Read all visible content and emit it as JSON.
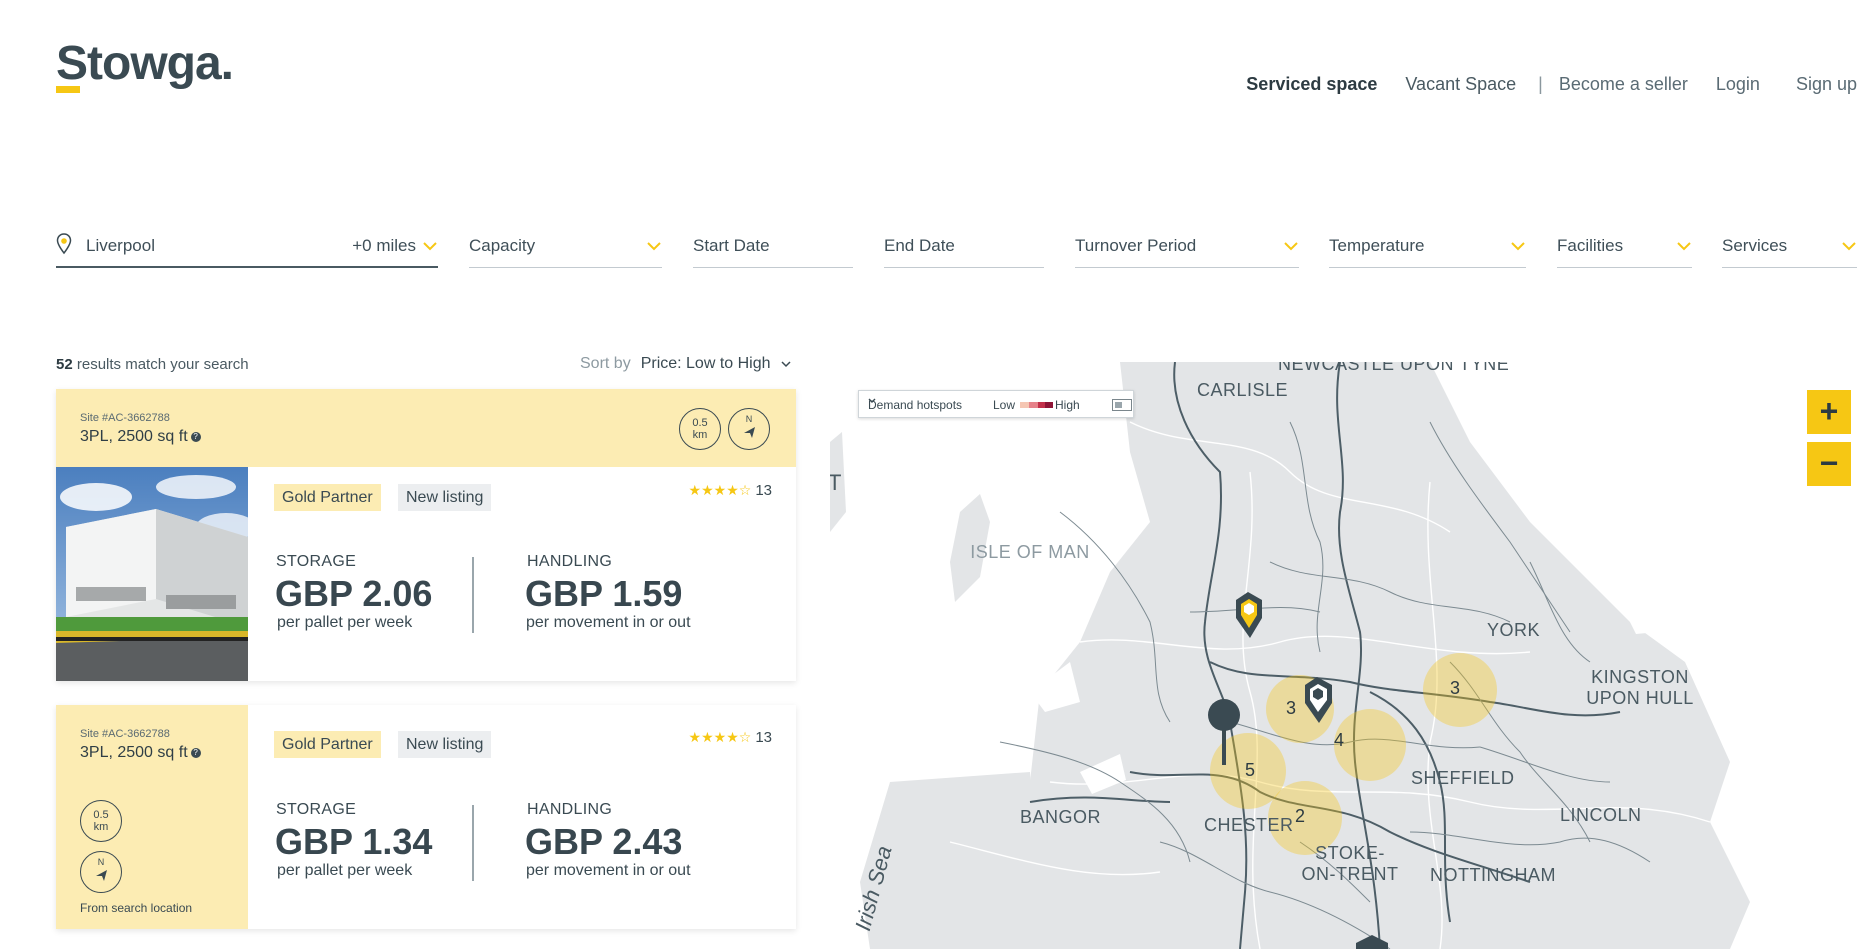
{
  "brand": {
    "name": "Stowga.",
    "accent": "#f6c714"
  },
  "nav": {
    "serviced": "Serviced space",
    "vacant": "Vacant Space",
    "separator": "|",
    "seller": "Become a seller",
    "login": "Login",
    "signup": "Sign up"
  },
  "filters": {
    "location": {
      "value": "Liverpool",
      "radius": "+0 miles"
    },
    "capacity": "Capacity",
    "start_date": "Start Date",
    "end_date": "End Date",
    "turnover": "Turnover Period",
    "temperature": "Temperature",
    "facilities": "Facilities",
    "services": "Services"
  },
  "results": {
    "count": "52",
    "count_suffix": " results match your search",
    "sort_label": "Sort by",
    "sort_value": "Price: Low to High"
  },
  "listings": [
    {
      "site_id": "Site #AC-3662788",
      "size": "3PL, 2500 sq ft",
      "distance_value": "0.5",
      "distance_unit": "km",
      "compass": "N",
      "badge_gold": "Gold Partner",
      "badge_new": "New listing",
      "rating": 4.5,
      "stars": "★★★★☆",
      "reviews": "13",
      "storage_label": "STORAGE",
      "storage_price": "GBP 2.06",
      "storage_unit": "per pallet per week",
      "handling_label": "HANDLING",
      "handling_price": "GBP 1.59",
      "handling_unit": "per movement in or out"
    },
    {
      "site_id": "Site #AC-3662788",
      "size": "3PL, 2500 sq ft",
      "distance_value": "0.5",
      "distance_unit": "km",
      "compass": "N",
      "from_label": "From search location",
      "badge_gold": "Gold Partner",
      "badge_new": "New listing",
      "rating": 4.5,
      "stars": "★★★★☆",
      "reviews": "13",
      "storage_label": "STORAGE",
      "storage_price": "GBP 1.34",
      "storage_unit": "per pallet per week",
      "handling_label": "HANDLING",
      "handling_price": "GBP 2.43",
      "handling_unit": "per movement in or out"
    }
  ],
  "map": {
    "legend": {
      "mode": "Demand hotspots",
      "low": "Low",
      "high": "High",
      "colors": [
        "#f5c6b3",
        "#e6828a",
        "#c2304a",
        "#8e1436"
      ]
    },
    "zoom_in": "+",
    "zoom_out": "−",
    "cities": {
      "newcastle": "NEWCASTLE UPON TYNE",
      "carlisle": "CARLISLE",
      "isle_of_man": "ISLE OF MAN",
      "york": "YORK",
      "hull": "KINGSTON UPON HULL",
      "sheffield": "SHEFFIELD",
      "bangor": "BANGOR",
      "chester": "CHESTER",
      "lincoln": "LINCOLN",
      "stoke": "STOKE-ON-TRENT",
      "nottingham": "NOTTINGHAM",
      "irish_sea": "Irish Sea",
      "edge_letter": "T"
    },
    "clusters": [
      "3",
      "3",
      "4",
      "5",
      "2"
    ]
  }
}
